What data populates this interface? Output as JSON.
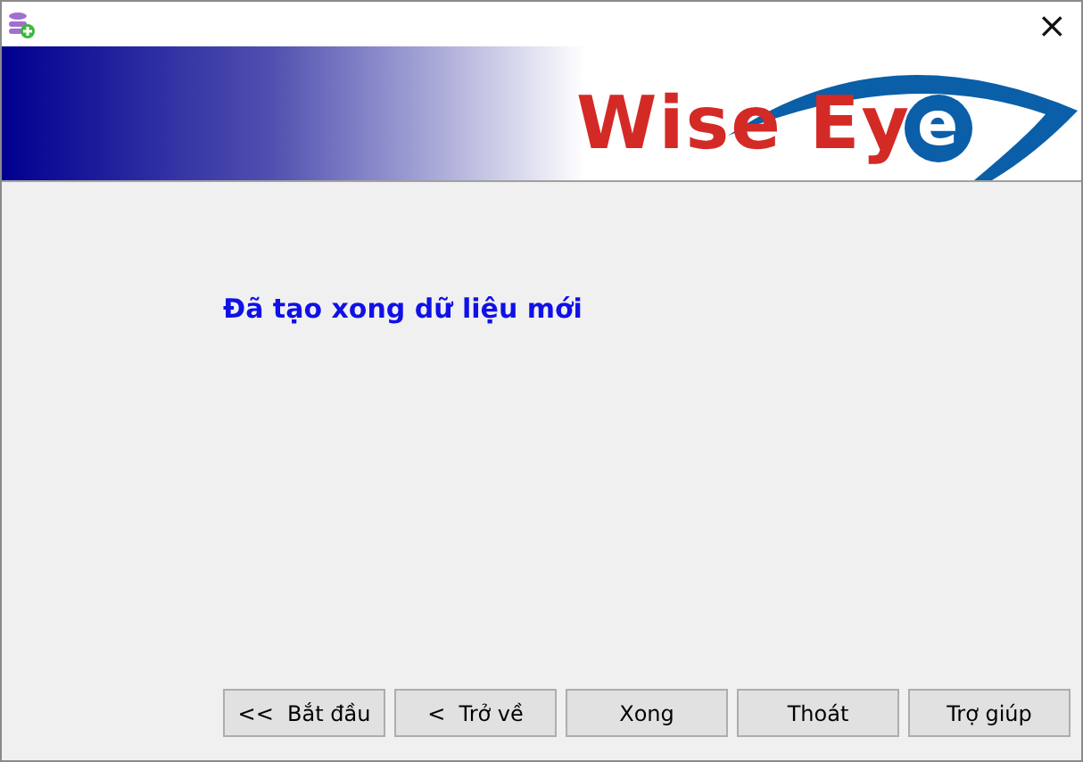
{
  "window": {
    "close": "×"
  },
  "logo": {
    "text": "Wise Ey",
    "circled": "e"
  },
  "message": "Đã tạo xong dữ liệu mới",
  "buttons": [
    {
      "label": "<<  Bắt đầu"
    },
    {
      "label": "<  Trở về"
    },
    {
      "label": "Xong"
    },
    {
      "label": "Thoát"
    },
    {
      "label": "Trợ giúp"
    }
  ]
}
